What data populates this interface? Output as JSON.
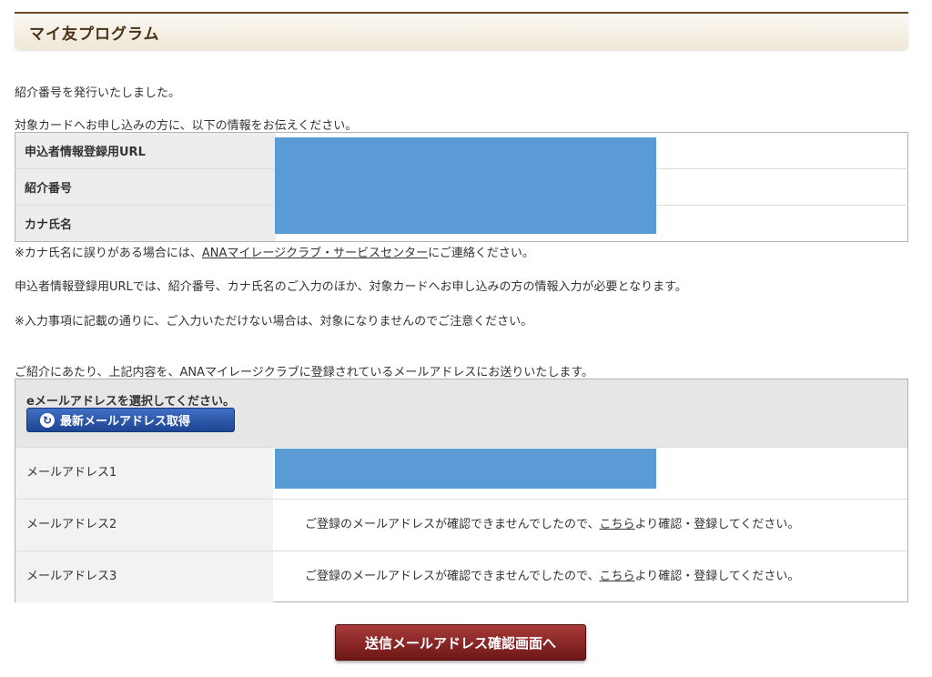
{
  "header": {
    "title": "マイ友プログラム"
  },
  "messages": {
    "issued": "紹介番号を発行いたしました。",
    "instruction": "対象カードへお申し込みの方に、以下の情報をお伝えください。"
  },
  "info_table": {
    "rows": [
      {
        "label": "申込者情報登録用URL"
      },
      {
        "label": "紹介番号"
      },
      {
        "label": "カナ氏名"
      }
    ]
  },
  "notes": {
    "kana_prefix": "※カナ氏名に誤りがある場合には、",
    "kana_link": "ANAマイレージクラブ・サービスセンター",
    "kana_suffix": "にご連絡ください。",
    "url_note": "申込者情報登録用URLでは、紹介番号、カナ氏名のご入力のほか、対象カードへお申し込みの方の情報入力が必要となります。",
    "warning": "※入力事項に記載の通りに、ご入力いただけない場合は、対象になりませんのでご注意ください。",
    "send_intro": "ご紹介にあたり、上記内容を、ANAマイレージクラブに登録されているメールアドレスにお送りいたします。"
  },
  "email_section": {
    "select_label": "eメールアドレスを選択してください。",
    "refresh_button": "最新メールアドレス取得",
    "rows": [
      {
        "label": "メールアドレス1"
      },
      {
        "label": "メールアドレス2",
        "prefix": "ご登録のメールアドレスが確認できませんでしたので、",
        "link": "こちら",
        "suffix": "より確認・登録してください。"
      },
      {
        "label": "メールアドレス3",
        "prefix": "ご登録のメールアドレスが確認できませんでしたので、",
        "link": "こちら",
        "suffix": "より確認・登録してください。"
      }
    ]
  },
  "submit_button": "送信メールアドレス確認画面へ",
  "icons": {
    "refresh": "refresh-icon",
    "arrow": "chevron-right-icon"
  },
  "colors": {
    "header_border": "#6b4a2a",
    "redaction": "#5b9bd5",
    "refresh_button": "#1e4592",
    "submit_button": "#8b2323"
  }
}
